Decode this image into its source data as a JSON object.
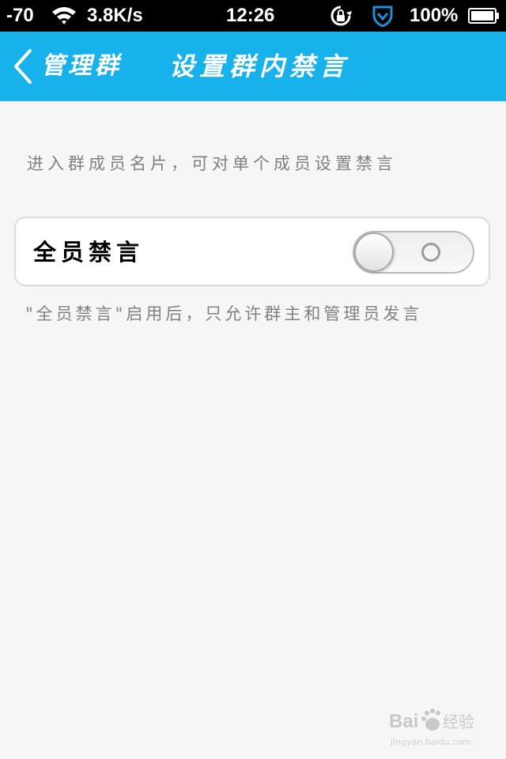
{
  "status_bar": {
    "signal": "-70",
    "speed": "3.8K/s",
    "time": "12:26",
    "battery_pct": "100%"
  },
  "nav": {
    "back_label": "管理群",
    "title": "设置群内禁言"
  },
  "content": {
    "intro": "进入群成员名片，可对单个成员设置禁言",
    "setting_label": "全员禁言",
    "toggle_state": "off",
    "note": "\"全员禁言\"启用后，只允许群主和管理员发言"
  },
  "watermark": {
    "brand": "Bai du 经验",
    "url": "jingyan.baidu.com"
  },
  "colors": {
    "nav_bg": "#17b1ec",
    "page_bg": "#f6f6f6"
  }
}
